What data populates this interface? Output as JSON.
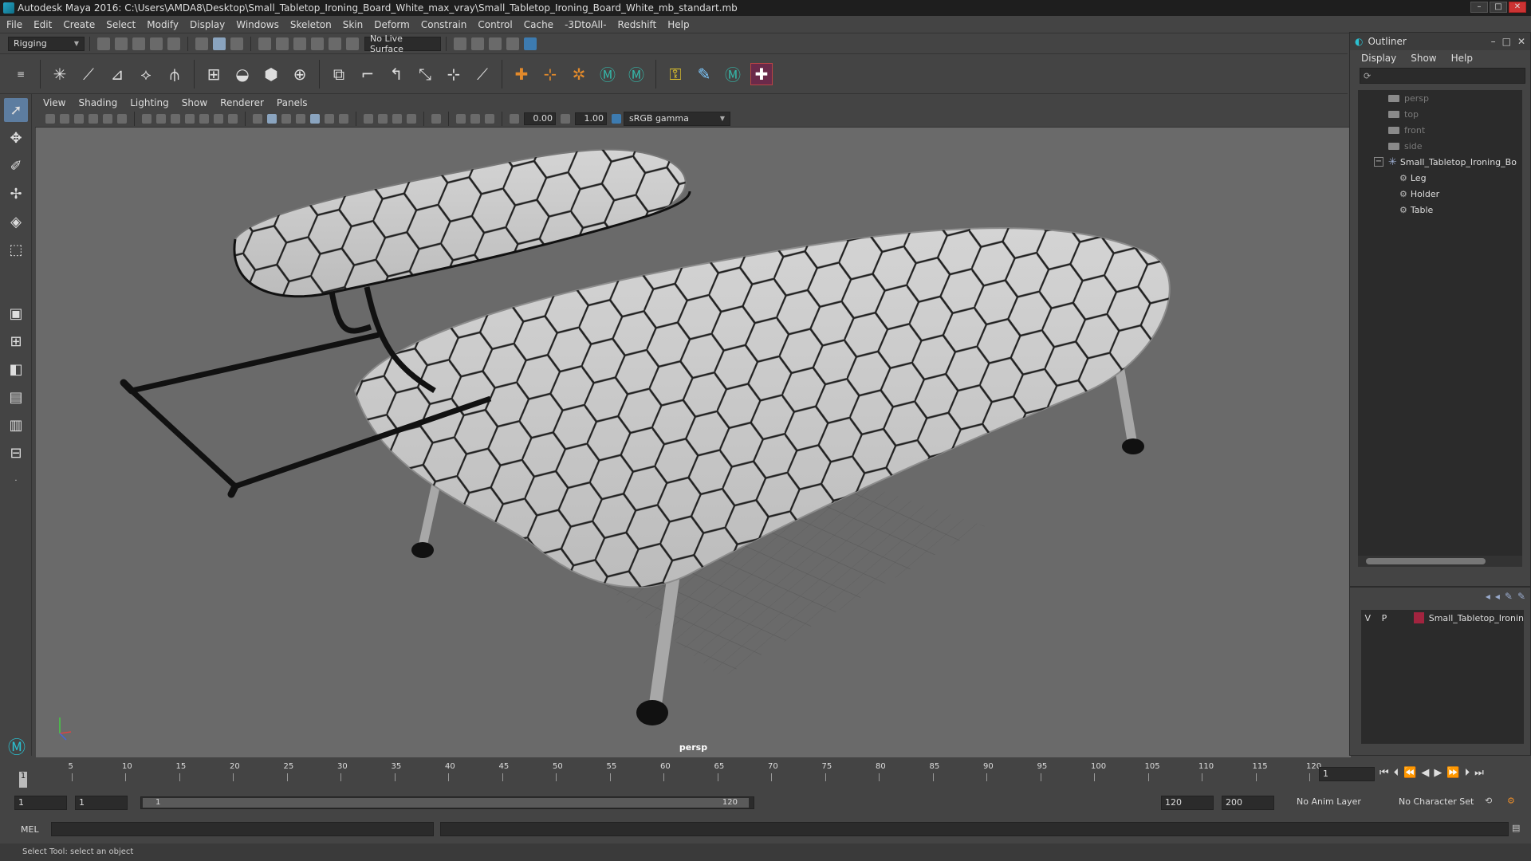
{
  "window": {
    "title": "Autodesk Maya 2016: C:\\Users\\AMDA8\\Desktop\\Small_Tabletop_Ironing_Board_White_max_vray\\Small_Tabletop_Ironing_Board_White_mb_standart.mb",
    "min": "–",
    "max": "□",
    "close": "✕"
  },
  "menubar": [
    "File",
    "Edit",
    "Create",
    "Select",
    "Modify",
    "Display",
    "Windows",
    "Skeleton",
    "Skin",
    "Deform",
    "Constrain",
    "Control",
    "Cache",
    "-3DtoAll-",
    "Redshift",
    "Help"
  ],
  "statusline": {
    "mode": "Rigging",
    "live_surface": "No Live Surface"
  },
  "panel": {
    "menu": [
      "View",
      "Shading",
      "Lighting",
      "Show",
      "Renderer",
      "Panels"
    ],
    "exposure": "0.00",
    "gamma": "1.00",
    "color_space": "sRGB gamma",
    "camera_label": "persp"
  },
  "outliner": {
    "title": "Outliner",
    "menu": [
      "Display",
      "Show",
      "Help"
    ],
    "items": [
      {
        "label": "persp",
        "kind": "camera"
      },
      {
        "label": "top",
        "kind": "camera"
      },
      {
        "label": "front",
        "kind": "camera"
      },
      {
        "label": "side",
        "kind": "camera"
      },
      {
        "label": "Small_Tabletop_Ironing_Bo",
        "kind": "group"
      },
      {
        "label": "Leg",
        "kind": "child"
      },
      {
        "label": "Holder",
        "kind": "child"
      },
      {
        "label": "Table",
        "kind": "child"
      }
    ]
  },
  "layers": {
    "v": "V",
    "p": "P",
    "name": "Small_Tabletop_Ironin",
    "color": "#a2243f"
  },
  "timeline": {
    "ticks": [
      "5",
      "10",
      "15",
      "20",
      "25",
      "30",
      "35",
      "40",
      "45",
      "50",
      "55",
      "60",
      "65",
      "70",
      "75",
      "80",
      "85",
      "90",
      "95",
      "100",
      "105",
      "110",
      "115",
      "120"
    ],
    "current": "1",
    "frame_field": "1"
  },
  "range": {
    "start": "1",
    "start2": "1",
    "inner_start": "1",
    "inner_end": "120",
    "end": "120",
    "end2": "200",
    "anim_layer": "No Anim Layer",
    "char_set": "No Character Set"
  },
  "cmd": {
    "label": "MEL",
    "help": "Select Tool: select an object"
  }
}
